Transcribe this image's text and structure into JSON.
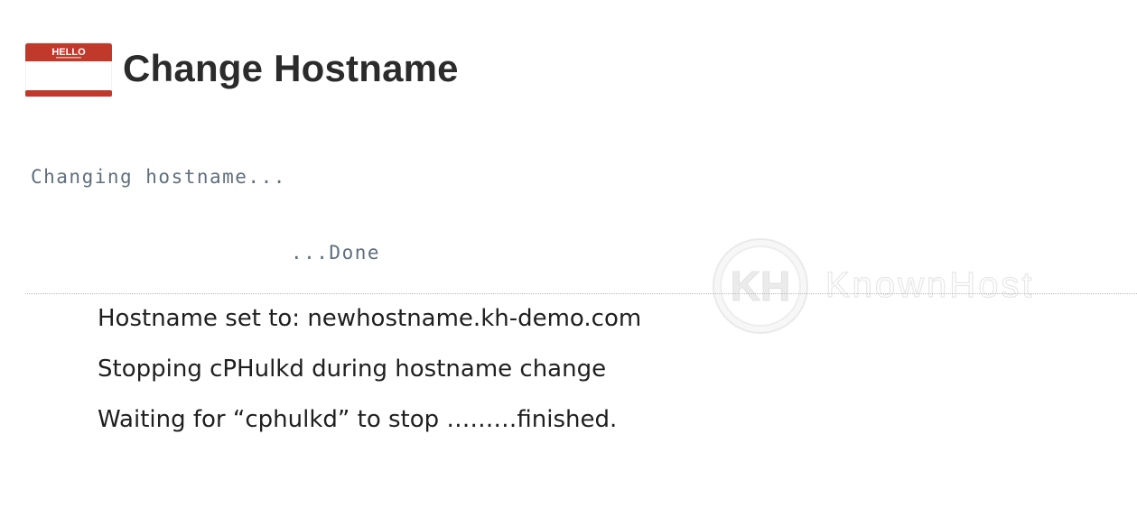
{
  "header": {
    "icon_text": "HELLO",
    "title": "Change Hostname"
  },
  "progress": {
    "changing_text": "Changing hostname...",
    "done_text": "...Done"
  },
  "log_lines": [
    "Hostname set to: newhostname.kh-demo.com",
    "Stopping cPHulkd during hostname change",
    "Waiting for “cphulkd” to stop ………finished."
  ],
  "watermark": {
    "monogram": "KH",
    "brand": "KnownHost"
  },
  "colors": {
    "tag_red": "#c0392b",
    "title": "#2b2b2b",
    "mono_text": "#5f6f7d",
    "body_text": "#1f1f1f"
  }
}
